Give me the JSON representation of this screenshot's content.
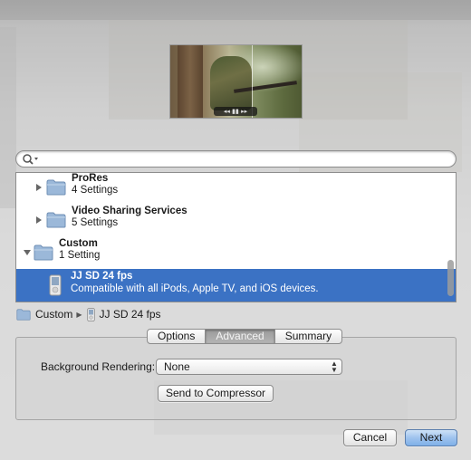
{
  "preview": {
    "controls_label": "◂◂ ▮▮ ▸▸"
  },
  "search": {
    "value": "",
    "placeholder": ""
  },
  "list": {
    "items": [
      {
        "title": "ProRes",
        "subtitle": "4 Settings",
        "kind": "folder",
        "expanded": false
      },
      {
        "title": "Video Sharing Services",
        "subtitle": "5 Settings",
        "kind": "folder",
        "expanded": false
      },
      {
        "title": "Custom",
        "subtitle": "1 Setting",
        "kind": "folder",
        "expanded": true
      },
      {
        "title": "JJ SD 24 fps",
        "subtitle": "Compatible with all iPods, Apple TV, and iOS devices.",
        "kind": "setting",
        "selected": true
      }
    ]
  },
  "pathbar": {
    "folder": "Custom",
    "setting": "JJ SD 24 fps"
  },
  "tabs": {
    "options": "Options",
    "advanced": "Advanced",
    "summary": "Summary",
    "active": "Advanced"
  },
  "advanced": {
    "background_rendering_label": "Background Rendering:",
    "background_rendering_value": "None",
    "send_to_compressor_label": "Send to Compressor"
  },
  "footer": {
    "cancel_label": "Cancel",
    "next_label": "Next"
  },
  "colors": {
    "selection": "#3b72c4",
    "default_button": "#9fc3ee"
  }
}
